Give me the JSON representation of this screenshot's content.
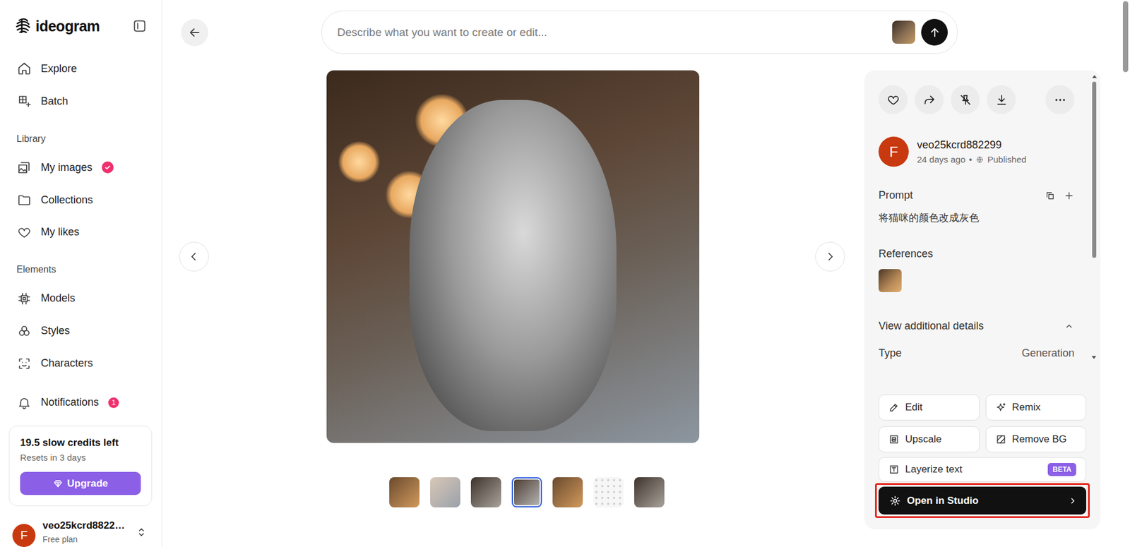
{
  "logo": "ideogram",
  "nav": [
    {
      "label": "Explore"
    },
    {
      "label": "Batch"
    }
  ],
  "groups": [
    {
      "title": "Library",
      "items": [
        {
          "label": "My images",
          "verified": true
        },
        {
          "label": "Collections",
          "verified": false
        },
        {
          "label": "My likes",
          "verified": false
        }
      ]
    },
    {
      "title": "Elements",
      "items": [
        {
          "label": "Models",
          "verified": false
        },
        {
          "label": "Styles",
          "verified": false
        },
        {
          "label": "Characters",
          "verified": false
        }
      ]
    }
  ],
  "notifications": {
    "label": "Notifications",
    "count": "1"
  },
  "credits": {
    "title": "19.5 slow credits left",
    "note": "Resets in 3 days",
    "button": "Upgrade"
  },
  "user": {
    "avatar": "F",
    "name": "veo25kcrd8822…",
    "plan": "Free plan"
  },
  "prompt_bar": {
    "placeholder": "Describe what you want to create or edit..."
  },
  "thumbnails": [
    {
      "kind": "image",
      "selected": false
    },
    {
      "kind": "image",
      "selected": false
    },
    {
      "kind": "image",
      "selected": false
    },
    {
      "kind": "image",
      "selected": true
    },
    {
      "kind": "image",
      "selected": false
    },
    {
      "kind": "pending",
      "selected": false
    },
    {
      "kind": "image",
      "selected": false
    }
  ],
  "details": {
    "author": {
      "avatar": "F",
      "name": "veo25kcrd882299",
      "time": "24 days ago",
      "separator": "•",
      "visibility": "Published"
    },
    "prompt_label": "Prompt",
    "prompt": "将猫咪的颜色改成灰色",
    "references_label": "References",
    "additional": {
      "label": "View additional details",
      "expanded": true
    },
    "rows": [
      {
        "label": "Type",
        "value": "Generation"
      }
    ]
  },
  "actions": [
    {
      "label": "Edit"
    },
    {
      "label": "Remix"
    },
    {
      "label": "Upscale"
    },
    {
      "label": "Remove BG"
    }
  ],
  "layerize": {
    "label": "Layerize text",
    "badge": "BETA"
  },
  "studio": {
    "label": "Open in Studio",
    "highlighted": true
  }
}
